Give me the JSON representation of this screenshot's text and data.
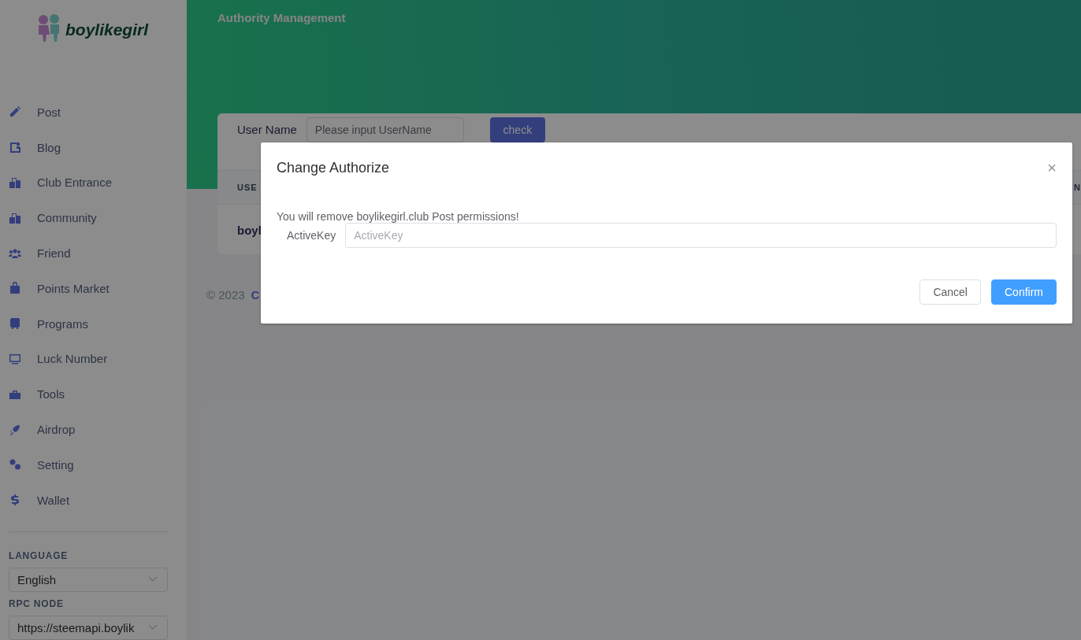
{
  "sidebar": {
    "logo": "boylikegirl",
    "items": [
      {
        "label": "Post"
      },
      {
        "label": "Blog"
      },
      {
        "label": "Club Entrance"
      },
      {
        "label": "Community"
      },
      {
        "label": "Friend"
      },
      {
        "label": "Points Market"
      },
      {
        "label": "Programs"
      },
      {
        "label": "Luck Number"
      },
      {
        "label": "Tools"
      },
      {
        "label": "Airdrop"
      },
      {
        "label": "Setting"
      },
      {
        "label": "Wallet"
      }
    ],
    "language": {
      "heading": "LANGUAGE",
      "value": "English"
    },
    "rpc_node": {
      "heading": "RPC NODE",
      "value": "https://steemapi.boylik"
    }
  },
  "header": {
    "title": "Authority Management"
  },
  "card": {
    "form": {
      "label": "User Name",
      "placeholder": "Please input UserName",
      "button": "check"
    },
    "table": {
      "columns": [
        "USE",
        "N"
      ],
      "rows": [
        [
          "boyl"
        ]
      ]
    }
  },
  "footer": {
    "copyright": "© 2023",
    "link": "C"
  },
  "dialog": {
    "title": "Change Authorize",
    "close": "×",
    "message": "You will remove boylikegirl.club Post permissions!",
    "field": {
      "label": "ActiveKey",
      "placeholder": "ActiveKey"
    },
    "buttons": [
      {
        "label": "Cancel",
        "kind": "secondary"
      },
      {
        "label": "Confirm",
        "kind": "primary"
      }
    ]
  }
}
